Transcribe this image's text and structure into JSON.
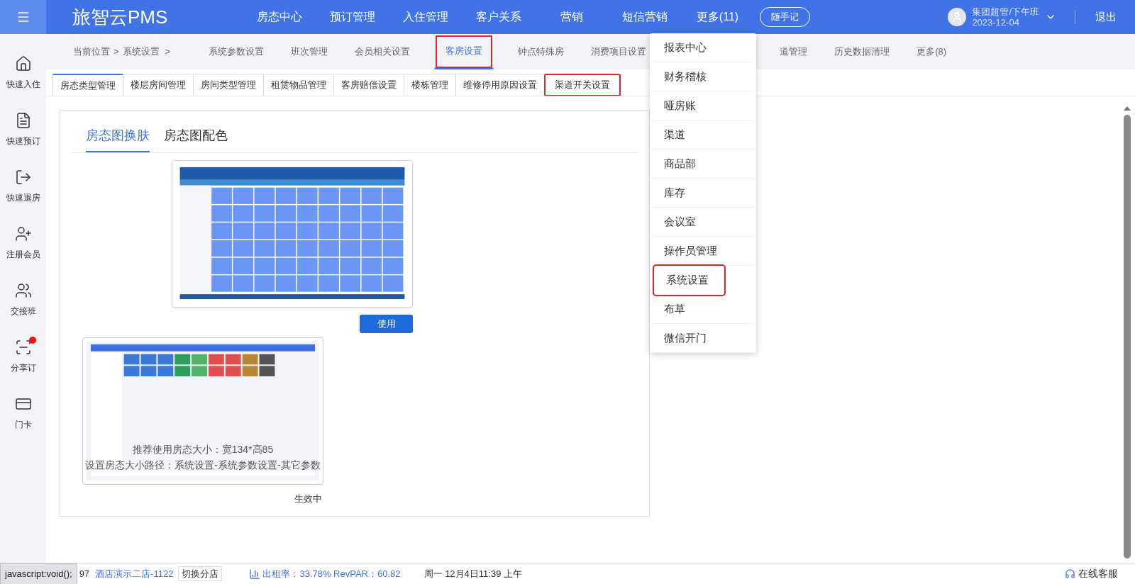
{
  "header": {
    "logo": "旅智云PMS",
    "nav": [
      {
        "label": "房态中心"
      },
      {
        "label": "预订管理"
      },
      {
        "label": "入住管理"
      },
      {
        "label": "客户关系"
      },
      {
        "label": "营销"
      },
      {
        "label": "短信营销"
      },
      {
        "label": "更多(11)"
      }
    ],
    "memo_button": "随手记",
    "user": {
      "name": "集团超管/下午班",
      "date": "2023-12-04"
    },
    "logout": "退出"
  },
  "sidebar": {
    "items": [
      {
        "label": "快速入住",
        "kind": "home",
        "badge": false
      },
      {
        "label": "快速预订",
        "kind": "book",
        "badge": false
      },
      {
        "label": "快速退房",
        "kind": "checkout",
        "badge": false
      },
      {
        "label": "注册会员",
        "kind": "member",
        "badge": false
      },
      {
        "label": "交接班",
        "kind": "shift",
        "badge": false
      },
      {
        "label": "分享订",
        "kind": "share",
        "badge": true
      },
      {
        "label": "门卡",
        "kind": "card",
        "badge": false
      }
    ]
  },
  "breadcrumb": {
    "label": "当前位置",
    "separator": ">",
    "path": "系统设置",
    "tabs": [
      {
        "label": "系统参数设置",
        "kind": "full",
        "selected": false,
        "highlighted": false
      },
      {
        "label": "班次管理",
        "kind": "full",
        "selected": false,
        "highlighted": false
      },
      {
        "label": "会员相关设置",
        "kind": "full",
        "selected": false,
        "highlighted": false
      },
      {
        "label": "客房设置",
        "kind": "full",
        "selected": true,
        "highlighted": true
      },
      {
        "label": "钟点特殊房",
        "kind": "full",
        "selected": false,
        "highlighted": false
      },
      {
        "label": "消费项目设置",
        "kind": "full",
        "selected": false,
        "highlighted": false
      },
      {
        "label": "道管理",
        "kind": "covered",
        "selected": false,
        "highlighted": false
      },
      {
        "label": "历史数据清理",
        "kind": "full",
        "selected": false,
        "highlighted": false
      },
      {
        "label": "更多(8)",
        "kind": "full",
        "selected": false,
        "highlighted": false
      }
    ]
  },
  "subtabs": [
    {
      "label": "房态类型管理",
      "selected": true,
      "highlighted": false
    },
    {
      "label": "楼层房间管理",
      "selected": false,
      "highlighted": false
    },
    {
      "label": "房间类型管理",
      "selected": false,
      "highlighted": false
    },
    {
      "label": "租赁物品管理",
      "selected": false,
      "highlighted": false
    },
    {
      "label": "客房赔偿设置",
      "selected": false,
      "highlighted": false
    },
    {
      "label": "楼栋管理",
      "selected": false,
      "highlighted": false
    },
    {
      "label": "维修停用原因设置",
      "selected": false,
      "highlighted": false
    },
    {
      "label": "渠道开关设置",
      "selected": false,
      "highlighted": true
    }
  ],
  "panel": {
    "tabs": [
      {
        "label": "房态图换肤",
        "selected": true
      },
      {
        "label": "房态图配色",
        "selected": false
      }
    ],
    "skins": [
      {
        "kind": "classic",
        "button": "使用"
      },
      {
        "kind": "modern",
        "notes": [
          "推荐使用房态大小：宽134*高85",
          "设置房态大小路径：系统设置-系统参数设置-其它参数"
        ],
        "status": "生效中"
      }
    ]
  },
  "dropdown": {
    "items": [
      {
        "label": "报表中心",
        "highlighted": false
      },
      {
        "label": "财务稽核",
        "highlighted": false
      },
      {
        "label": "哑房账",
        "highlighted": false
      },
      {
        "label": "渠道",
        "highlighted": false
      },
      {
        "label": "商品部",
        "highlighted": false
      },
      {
        "label": "库存",
        "highlighted": false
      },
      {
        "label": "会议室",
        "highlighted": false
      },
      {
        "label": "操作员管理",
        "highlighted": false
      },
      {
        "label": "系统设置",
        "highlighted": true
      },
      {
        "label": "布草",
        "highlighted": false
      },
      {
        "label": "微信开门",
        "highlighted": false
      }
    ]
  },
  "status_bar": {
    "tooltip": "javascript:void();",
    "code": "97",
    "hotel": "酒店演示二店-1122",
    "switch": "切换分店",
    "occupancy": "出租率：33.78% RevPAR：60.82",
    "time": "周一 12月4日11:39 上午",
    "service": "在线客服"
  }
}
